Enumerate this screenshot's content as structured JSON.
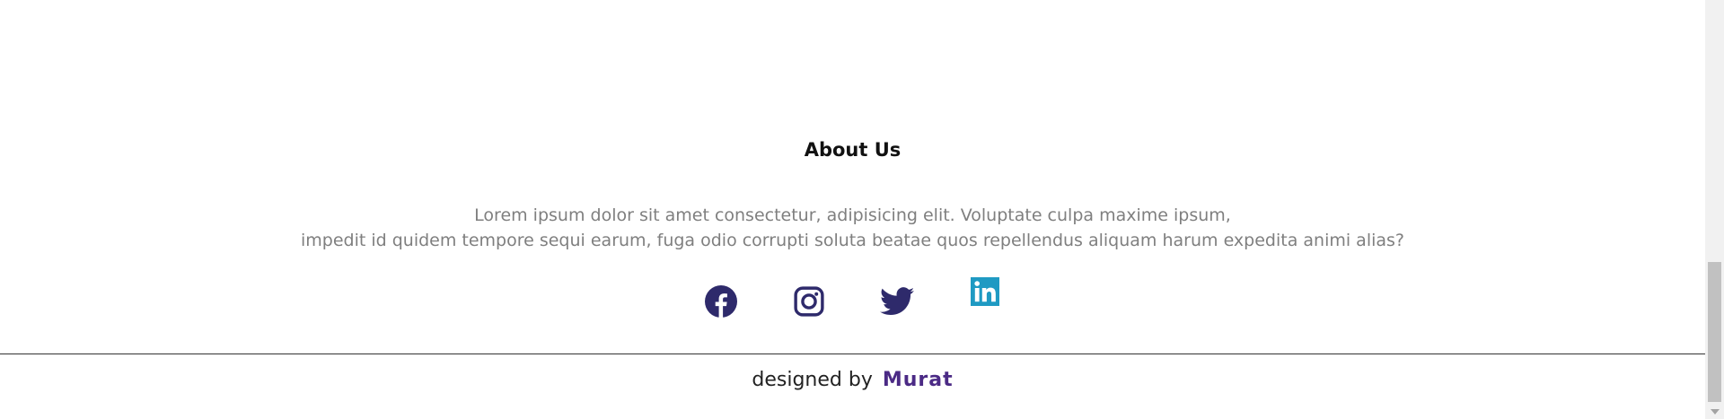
{
  "about": {
    "title": "About Us",
    "line1": "Lorem ipsum dolor sit amet consectetur, adipisicing elit. Voluptate culpa maxime ipsum,",
    "line2": "impedit id quidem tempore sequi earum, fuga odio corrupti soluta beatae quos repellendus aliquam harum expedita animi alias?"
  },
  "social": [
    {
      "name": "facebook-icon",
      "color": "#2e2a6b"
    },
    {
      "name": "instagram-icon",
      "color": "#2e2a6b"
    },
    {
      "name": "twitter-icon",
      "color": "#2e2a6b"
    },
    {
      "name": "linkedin-icon",
      "color": "#1f9ac3"
    }
  ],
  "footer": {
    "prefix": "designed by",
    "author": "Murat",
    "author_color": "#4b2a85"
  }
}
